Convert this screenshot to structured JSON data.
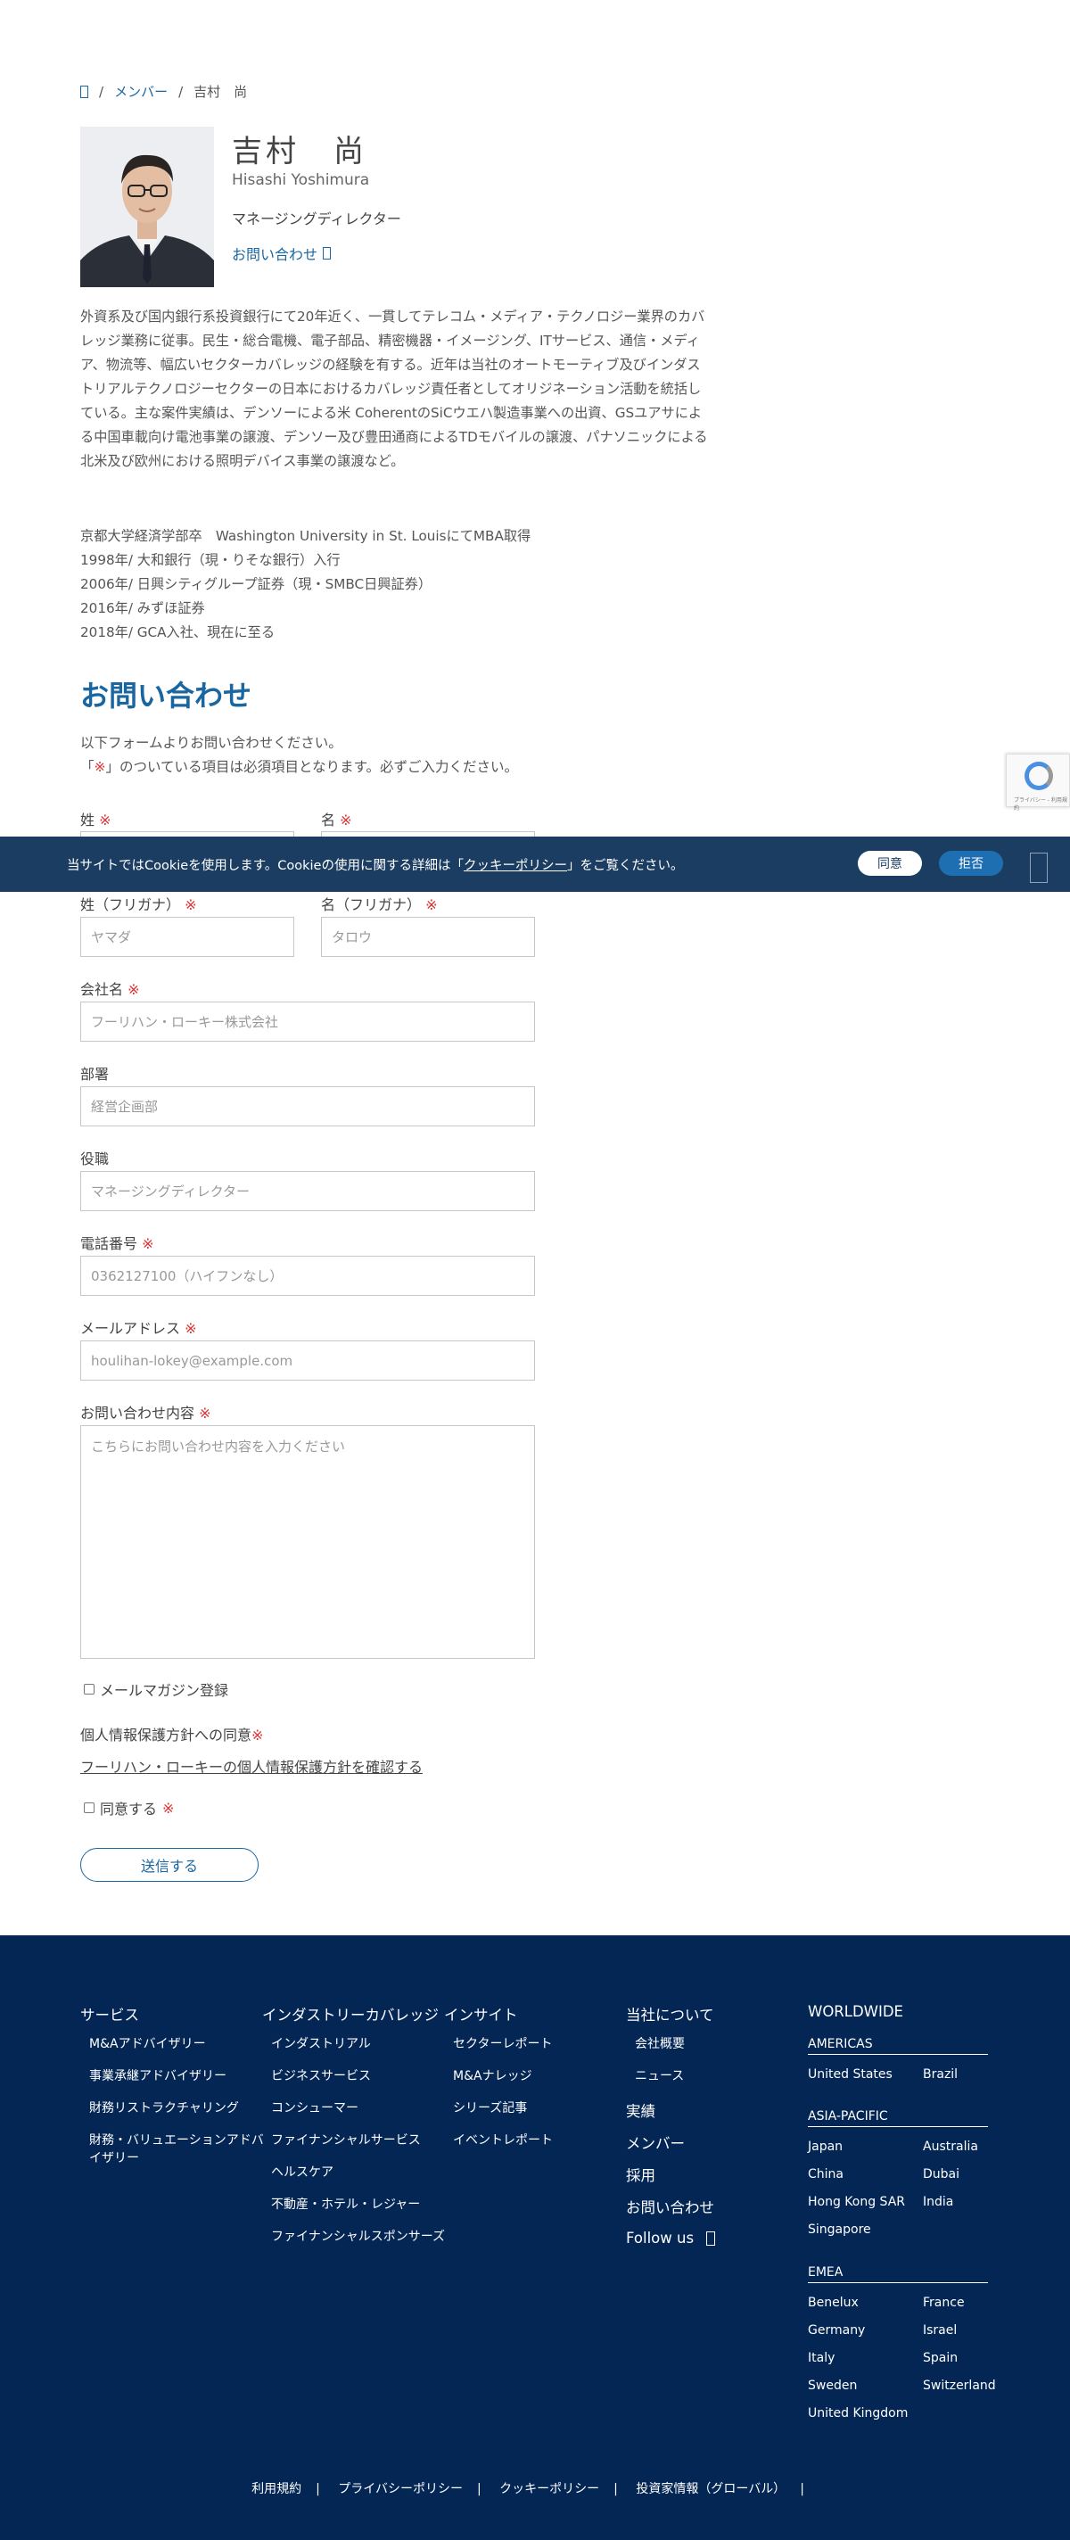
{
  "breadcrumb": {
    "home_icon": "home-icon",
    "sep": "/",
    "members": "メンバー",
    "current": "吉村　尚"
  },
  "profile": {
    "name": "吉村　尚",
    "name_en": "Hisashi Yoshimura",
    "title": "マネージングディレクター",
    "contact": "お問い合わせ",
    "bio": "外資系及び国内銀行系投資銀行にて20年近く、一貫してテレコム・メディア・テクノロジー業界のカバレッジ業務に従事。民生・総合電機、電子部品、精密機器・イメージング、ITサービス、通信・メディア、物流等、幅広いセクターカバレッジの経験を有する。近年は当社のオートモーティブ及びインダストリアルテクノロジーセクターの日本におけるカバレッジ責任者としてオリジネーション活動を統括している。主な案件実績は、デンソーによる米 CoherentのSiCウエハ製造事業への出資、GSユアサによる中国車載向け電池事業の譲渡、デンソー及び豊田通商によるTDモバイルの譲渡、パナソニックによる北米及び欧州における照明デバイス事業の譲渡など。",
    "career": [
      "京都大学経済学部卒　Washington University in St. LouisにてMBA取得",
      "1998年/ 大和銀行（現・りそな銀行）入行",
      "2006年/ 日興シティグループ証券（現・SMBC日興証券）",
      "2016年/ みずほ証券",
      "2018年/ GCA入社、現在に至る"
    ]
  },
  "form": {
    "heading": "お問い合わせ",
    "intro1": "以下フォームよりお問い合わせください。",
    "intro2_a": "「",
    "intro2_mark": "※",
    "intro2_b": "」のついている項目は必須項目となります。必ずご入力ください。",
    "req": "※",
    "last_name": "姓",
    "first_name": "名",
    "last_kana": "姓（フリガナ）",
    "last_kana_ph": "ヤマダ",
    "first_kana": "名（フリガナ）",
    "first_kana_ph": "タロウ",
    "company": "会社名",
    "company_ph": "フーリハン・ローキー株式会社",
    "dept": "部署",
    "dept_ph": "経営企画部",
    "position": "役職",
    "position_ph": "マネージングディレクター",
    "phone": "電話番号",
    "phone_ph": "0362127100（ハイフンなし）",
    "email": "メールアドレス",
    "email_ph": "houlihan-lokey@example.com",
    "inquiry": "お問い合わせ内容",
    "inquiry_ph": "こちらにお問い合わせ内容を入力ください",
    "newsletter": "メールマガジン登録",
    "privacy_label": "個人情報保護方針への同意",
    "privacy_link": "フーリハン・ローキーの個人情報保護方針を確認する",
    "agree": "同意する",
    "submit": "送信する"
  },
  "cookie": {
    "text_a": "当サイトではCookieを使用します。Cookieの使用に関する詳細は「",
    "link": "クッキーポリシー",
    "text_b": "」をご覧ください。",
    "agree": "同意",
    "reject": "拒否"
  },
  "recaptcha": {
    "text": "プライバシー - 利用規約"
  },
  "footer": {
    "services": {
      "heading": "サービス",
      "items": [
        "M&Aアドバイザリー",
        "事業承継アドバイザリー",
        "財務リストラクチャリング",
        "財務・バリュエーションアドバイザリー"
      ]
    },
    "industry": {
      "heading": "インダストリーカバレッジ",
      "items": [
        "インダストリアル",
        "ビジネスサービス",
        "コンシューマー",
        "ファイナンシャルサービス",
        "ヘルスケア",
        "不動産・ホテル・レジャー",
        "ファイナンシャルスポンサーズ"
      ]
    },
    "insight": {
      "heading": "インサイト",
      "items": [
        "セクターレポート",
        "M&Aナレッジ",
        "シリーズ記事",
        "イベントレポート"
      ]
    },
    "about": {
      "heading": "当社について",
      "items": [
        "会社概要",
        "ニュース"
      ],
      "links": [
        "実績",
        "メンバー",
        "採用",
        "お問い合わせ"
      ],
      "follow": "Follow us"
    },
    "worldwide": {
      "heading": "WORLDWIDE",
      "americas": {
        "label": "AMERICAS",
        "items": [
          "United States",
          "Brazil"
        ]
      },
      "apac": {
        "label": "ASIA-PACIFIC",
        "items": [
          "Japan",
          "Australia",
          "China",
          "Dubai",
          "Hong Kong SAR",
          "India",
          "Singapore"
        ]
      },
      "emea": {
        "label": "EMEA",
        "items": [
          "Benelux",
          "France",
          "Germany",
          "Israel",
          "Italy",
          "Spain",
          "Sweden",
          "Switzerland",
          "United Kingdom"
        ]
      }
    },
    "bottom": [
      "利用規約",
      "プライバシーポリシー",
      "クッキーポリシー",
      "投資家情報（グローバル）"
    ],
    "sep": "|"
  }
}
